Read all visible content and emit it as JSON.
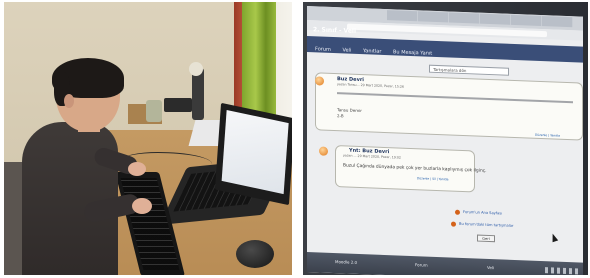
{
  "left_photo": {
    "description_icon": "child-at-computer"
  },
  "right_photo": {
    "page_title": "2. Sınıf - Veli",
    "nav": {
      "items": [
        "Forum",
        "Veli",
        "Yanıtlar",
        "Bu Mesaja Yanıt"
      ]
    },
    "select_text": "Tartışmalara dön",
    "message1": {
      "title": "Buz Devri",
      "meta": "yazan Tansu... 29 Mart 2020, Pazar, 15:26",
      "signature_name": "Tansu Demir",
      "signature_class": "2-B",
      "reply_link": "Düzenle | Yanıtla"
    },
    "message2": {
      "title": "Ynt: Buz Devri",
      "meta": "yazan ... 29 Mart 2020, Pazar, 19:02",
      "text": "Buzul Çağında dünyada pek çok yer buzlarla kaplıymış çok ilginç.",
      "reply_link": "Düzenle | Sil | Yanıtla"
    },
    "actions": {
      "link1": "Forum'un Ana Sayfası",
      "link2": "Bu forum'daki tüm tartışmalar",
      "back_button": "Geri"
    },
    "taskbar": {
      "item1": "Moodle 2.0",
      "item2": "Forum",
      "item3": "Veli"
    }
  }
}
